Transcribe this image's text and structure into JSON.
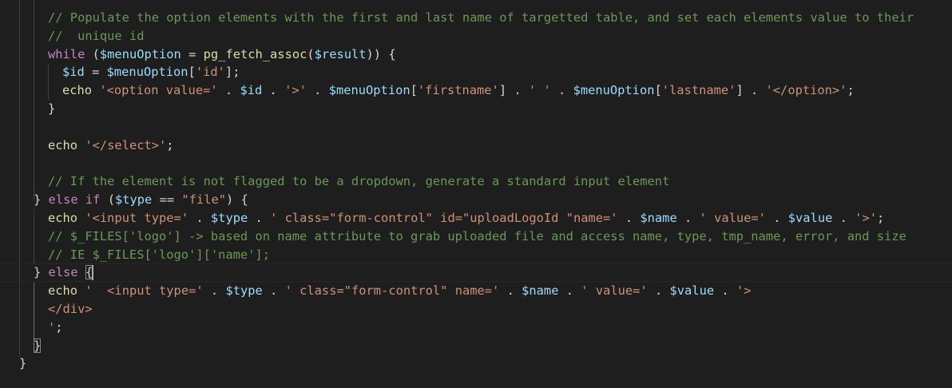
{
  "editor": {
    "theme_colors": {
      "background": "#1e1e1e",
      "comment": "#6a9955",
      "keyword": "#c586c0",
      "variable": "#9cdcfe",
      "function": "#dcdcaa",
      "string": "#ce9178",
      "text": "#d4d4d4"
    },
    "lines": [
      {
        "id": "l1",
        "tokens": [
          {
            "t": "c",
            "v": "// Populate the option elements with the first and last name of targetted table, and set each elements value to their"
          }
        ]
      },
      {
        "id": "l2",
        "tokens": [
          {
            "t": "c",
            "v": "//  unique id"
          }
        ]
      },
      {
        "id": "l3",
        "tokens": [
          {
            "t": "k",
            "v": "while"
          },
          {
            "t": "p",
            "v": " ("
          },
          {
            "t": "v",
            "v": "$menuOption"
          },
          {
            "t": "p",
            "v": " = "
          },
          {
            "t": "f",
            "v": "pg_fetch_assoc"
          },
          {
            "t": "p",
            "v": "("
          },
          {
            "t": "v",
            "v": "$result"
          },
          {
            "t": "p",
            "v": ")) {"
          }
        ]
      },
      {
        "id": "l4",
        "tokens": [
          {
            "t": "v",
            "v": "$id"
          },
          {
            "t": "p",
            "v": " = "
          },
          {
            "t": "v",
            "v": "$menuOption"
          },
          {
            "t": "p",
            "v": "["
          },
          {
            "t": "s",
            "v": "'id'"
          },
          {
            "t": "p",
            "v": "];"
          }
        ]
      },
      {
        "id": "l5",
        "tokens": [
          {
            "t": "f",
            "v": "echo"
          },
          {
            "t": "p",
            "v": " "
          },
          {
            "t": "s",
            "v": "'<option value='"
          },
          {
            "t": "p",
            "v": " . "
          },
          {
            "t": "v",
            "v": "$id"
          },
          {
            "t": "p",
            "v": " . "
          },
          {
            "t": "s",
            "v": "'>'"
          },
          {
            "t": "p",
            "v": " . "
          },
          {
            "t": "v",
            "v": "$menuOption"
          },
          {
            "t": "p",
            "v": "["
          },
          {
            "t": "s",
            "v": "'firstname'"
          },
          {
            "t": "p",
            "v": "] . "
          },
          {
            "t": "s",
            "v": "' '"
          },
          {
            "t": "p",
            "v": " . "
          },
          {
            "t": "v",
            "v": "$menuOption"
          },
          {
            "t": "p",
            "v": "["
          },
          {
            "t": "s",
            "v": "'lastname'"
          },
          {
            "t": "p",
            "v": "] . "
          },
          {
            "t": "s",
            "v": "'</option>'"
          },
          {
            "t": "p",
            "v": ";"
          }
        ]
      },
      {
        "id": "l6",
        "tokens": [
          {
            "t": "p",
            "v": "}"
          }
        ]
      },
      {
        "id": "l7",
        "tokens": []
      },
      {
        "id": "l8",
        "tokens": [
          {
            "t": "f",
            "v": "echo"
          },
          {
            "t": "p",
            "v": " "
          },
          {
            "t": "s",
            "v": "'</select>'"
          },
          {
            "t": "p",
            "v": ";"
          }
        ]
      },
      {
        "id": "l9",
        "tokens": []
      },
      {
        "id": "l10",
        "tokens": [
          {
            "t": "c",
            "v": "// If the element is not flagged to be a dropdown, generate a standard input element"
          }
        ]
      },
      {
        "id": "l11",
        "tokens": [
          {
            "t": "p",
            "v": "} "
          },
          {
            "t": "k",
            "v": "else if"
          },
          {
            "t": "p",
            "v": " ("
          },
          {
            "t": "v",
            "v": "$type"
          },
          {
            "t": "p",
            "v": " == "
          },
          {
            "t": "s",
            "v": "\"file\""
          },
          {
            "t": "p",
            "v": ") {"
          }
        ]
      },
      {
        "id": "l12",
        "tokens": [
          {
            "t": "f",
            "v": "echo"
          },
          {
            "t": "p",
            "v": " "
          },
          {
            "t": "s",
            "v": "'<input type='"
          },
          {
            "t": "p",
            "v": " . "
          },
          {
            "t": "v",
            "v": "$type"
          },
          {
            "t": "p",
            "v": " . "
          },
          {
            "t": "s",
            "v": "' class=\"form-control\" id=\"uploadLogoId \"name='"
          },
          {
            "t": "p",
            "v": " . "
          },
          {
            "t": "v",
            "v": "$name"
          },
          {
            "t": "p",
            "v": " . "
          },
          {
            "t": "s",
            "v": "' value='"
          },
          {
            "t": "p",
            "v": " . "
          },
          {
            "t": "v",
            "v": "$value"
          },
          {
            "t": "p",
            "v": " . "
          },
          {
            "t": "s",
            "v": "'>'"
          },
          {
            "t": "p",
            "v": ";"
          }
        ]
      },
      {
        "id": "l13",
        "tokens": [
          {
            "t": "c",
            "v": "// $_FILES['logo'] -> based on name attribute to grab uploaded file and access name, type, tmp_name, error, and size"
          }
        ]
      },
      {
        "id": "l14",
        "tokens": [
          {
            "t": "c",
            "v": "// IE $_FILES['logo']['name'];"
          }
        ]
      },
      {
        "id": "l15",
        "tokens": [
          {
            "t": "p",
            "v": "} "
          },
          {
            "t": "k",
            "v": "else"
          },
          {
            "t": "p",
            "v": " "
          },
          {
            "t": "p",
            "v": "{",
            "bracket": true
          }
        ]
      },
      {
        "id": "l16",
        "tokens": [
          {
            "t": "f",
            "v": "echo"
          },
          {
            "t": "p",
            "v": " "
          },
          {
            "t": "s",
            "v": "'  <input type='"
          },
          {
            "t": "p",
            "v": " . "
          },
          {
            "t": "v",
            "v": "$type"
          },
          {
            "t": "p",
            "v": " . "
          },
          {
            "t": "s",
            "v": "' class=\"form-control\" name='"
          },
          {
            "t": "p",
            "v": " . "
          },
          {
            "t": "v",
            "v": "$name"
          },
          {
            "t": "p",
            "v": " . "
          },
          {
            "t": "s",
            "v": "' value='"
          },
          {
            "t": "p",
            "v": " . "
          },
          {
            "t": "v",
            "v": "$value"
          },
          {
            "t": "p",
            "v": " . "
          },
          {
            "t": "s",
            "v": "'>"
          }
        ]
      },
      {
        "id": "l17",
        "tokens": [
          {
            "t": "s",
            "v": "</div>"
          }
        ]
      },
      {
        "id": "l18",
        "tokens": [
          {
            "t": "s",
            "v": "'"
          },
          {
            "t": "p",
            "v": ";"
          }
        ]
      },
      {
        "id": "l19",
        "tokens": [
          {
            "t": "p",
            "v": "}",
            "bracket": true
          }
        ]
      },
      {
        "id": "l20",
        "tokens": [
          {
            "t": "p",
            "v": "}"
          }
        ]
      }
    ]
  }
}
